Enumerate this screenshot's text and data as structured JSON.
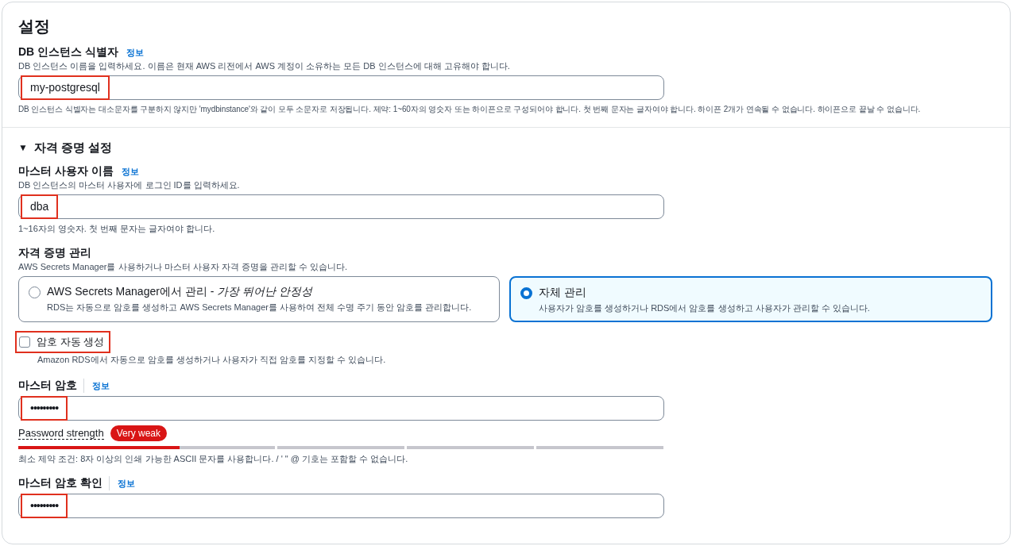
{
  "title": "설정",
  "instance_field": {
    "label": "DB 인스턴스 식별자",
    "info": "정보",
    "description": "DB 인스턴스 이름을 입력하세요. 이름은 현재 AWS 리전에서 AWS 계정이 소유하는 모든 DB 인스턴스에 대해 고유해야 합니다.",
    "value": "my-postgresql",
    "highlighted": true,
    "hint": "DB 인스턴스 식별자는 대소문자를 구분하지 않지만 'mydbinstance'와 같이 모두 소문자로 저장됩니다. 제약: 1~60자의 영숫자 또는 하이픈으로 구성되어야 합니다. 첫 번째 문자는 글자여야 합니다. 하이픈 2개가 연속될 수 없습니다. 하이픈으로 끝날 수 없습니다."
  },
  "credentials": {
    "toggle": "▼",
    "title": "자격 증명 설정",
    "expanded": true,
    "username_field": {
      "label": "마스터 사용자 이름",
      "info": "정보",
      "description": "DB 인스턴스의 마스터 사용자에 로그인 ID를 입력하세요.",
      "value": "dba",
      "highlighted": true,
      "hint": "1~16자의 영숫자. 첫 번째 문자는 글자여야 합니다."
    },
    "management": {
      "label": "자격 증명 관리",
      "description": "AWS Secrets Manager를 사용하거나 마스터 사용자 자격 증명을 관리할 수 있습니다.",
      "options": [
        {
          "title": "AWS Secrets Manager에서 관리 - *가장 뛰어난 안정성*",
          "description": "RDS는 자동으로 암호를 생성하고 AWS Secrets Manager를 사용하여 전체 수명 주기 동안 암호를 관리합니다.",
          "selected": false
        },
        {
          "title": "자체 관리",
          "description": "사용자가 암호를 생성하거나 RDS에서 암호를 생성하고 사용자가 관리할 수 있습니다.",
          "selected": true
        }
      ]
    },
    "auto_generate": {
      "label": "암호 자동 생성",
      "checked": false,
      "highlighted": true,
      "description": "Amazon RDS에서 자동으로 암호를 생성하거나 사용자가 직접 암호를 지정할 수 있습니다."
    },
    "password_field": {
      "label": "마스터 암호",
      "info": "정보",
      "value": "•••••••••",
      "highlighted": true
    },
    "strength": {
      "label": "Password strength",
      "badge": "Very weak",
      "level": 0.25
    },
    "password_hint": "최소 제약 조건: 8자 이상의 인쇄 가능한 ASCII 문자를 사용합니다. / ' \" @ 기호는 포함할 수 없습니다.",
    "confirm_field": {
      "label": "마스터 암호 확인",
      "info": "정보",
      "value": "•••••••••",
      "highlighted": true
    }
  }
}
